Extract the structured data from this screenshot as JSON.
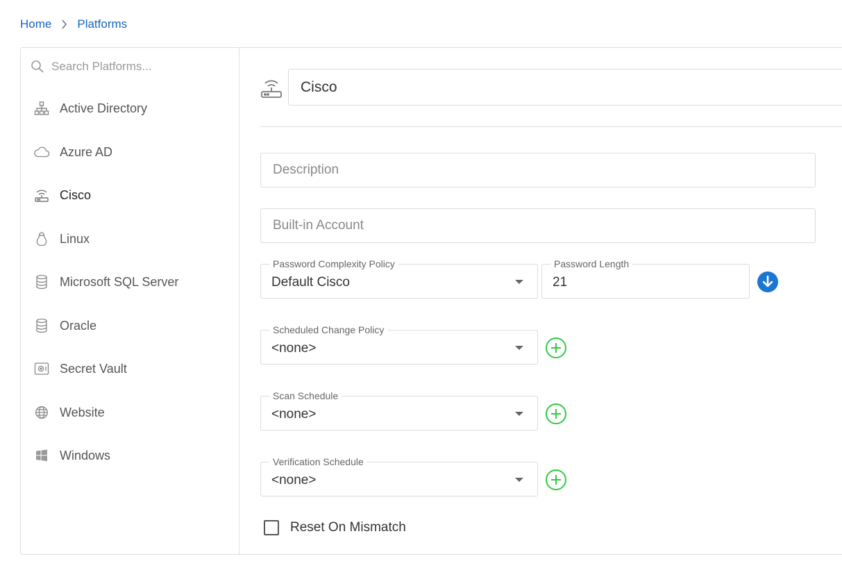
{
  "breadcrumb": {
    "home": "Home",
    "current": "Platforms"
  },
  "search": {
    "placeholder": "Search Platforms..."
  },
  "sidebar": {
    "items": [
      {
        "label": "Active Directory",
        "icon": "sitemap-icon"
      },
      {
        "label": "Azure AD",
        "icon": "cloud-icon"
      },
      {
        "label": "Cisco",
        "icon": "router-icon",
        "active": true
      },
      {
        "label": "Linux",
        "icon": "linux-icon"
      },
      {
        "label": "Microsoft SQL Server",
        "icon": "database-icon"
      },
      {
        "label": "Oracle",
        "icon": "database-icon"
      },
      {
        "label": "Secret Vault",
        "icon": "vault-icon"
      },
      {
        "label": "Website",
        "icon": "globe-icon"
      },
      {
        "label": "Windows",
        "icon": "windows-icon"
      }
    ]
  },
  "platform": {
    "name": "Cisco",
    "description_placeholder": "Description",
    "builtin_account_placeholder": "Built-in Account",
    "password_complexity": {
      "label": "Password Complexity Policy",
      "value": "Default Cisco"
    },
    "password_length": {
      "label": "Password Length",
      "value": "21"
    },
    "scheduled_change": {
      "label": "Scheduled Change Policy",
      "value": "<none>"
    },
    "scan_schedule": {
      "label": "Scan Schedule",
      "value": "<none>"
    },
    "verification_schedule": {
      "label": "Verification Schedule",
      "value": "<none>"
    },
    "reset_on_mismatch": {
      "label": "Reset On Mismatch",
      "checked": false
    }
  },
  "colors": {
    "link": "#1565c0",
    "add": "#2ecc40",
    "download": "#1976d2"
  }
}
